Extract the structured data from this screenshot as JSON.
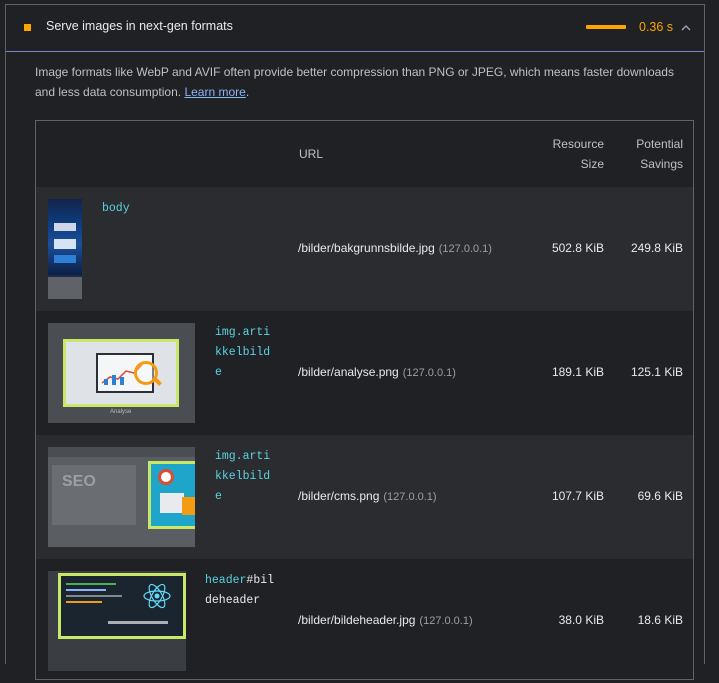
{
  "audit": {
    "title": "Serve images in next-gen formats",
    "savings": "0.36 s",
    "description_text": "Image formats like WebP and AVIF often provide better compression than PNG or JPEG, which means faster downloads and less data consumption.",
    "learn_more": "Learn more",
    "description_end": "."
  },
  "table": {
    "headers": {
      "url": "URL",
      "resource_size_1": "Resource",
      "resource_size_2": "Size",
      "potential_savings_1": "Potential",
      "potential_savings_2": "Savings"
    },
    "rows": [
      {
        "node_tag": "body",
        "node_rest": "",
        "url": "/bilder/bakgrunnsbilde.jpg",
        "host": "(127.0.0.1)",
        "size": "502.8 KiB",
        "savings": "249.8 KiB"
      },
      {
        "node_tag": "img.artikkelbilde",
        "node_rest": "",
        "url": "/bilder/analyse.png",
        "host": "(127.0.0.1)",
        "size": "189.1 KiB",
        "savings": "125.1 KiB",
        "thumb_text": "Analyse"
      },
      {
        "node_tag": "img.artikkelbilde",
        "node_rest": "",
        "url": "/bilder/cms.png",
        "host": "(127.0.0.1)",
        "size": "107.7 KiB",
        "savings": "69.6 KiB",
        "thumb_text": "SEO"
      },
      {
        "node_tag": "header",
        "node_rest": "#bildeheader",
        "url": "/bilder/bildeheader.jpg",
        "host": "(127.0.0.1)",
        "size": "38.0 KiB",
        "savings": "18.6 KiB"
      }
    ]
  },
  "colors": {
    "accent_average": "#ffa400",
    "link": "#8ab4f8",
    "node": "#5ad3e0"
  }
}
